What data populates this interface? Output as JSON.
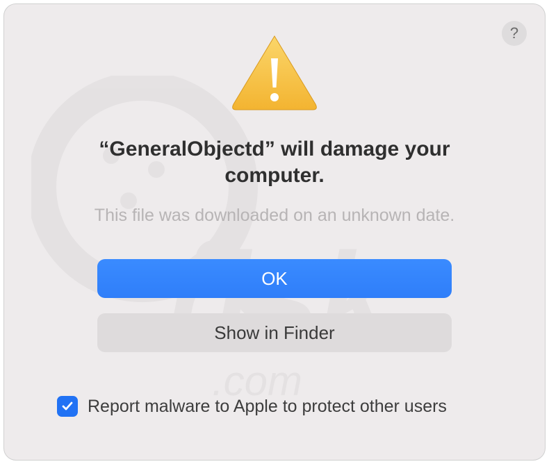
{
  "dialog": {
    "title": "“GeneralObjectd” will damage your computer.",
    "subtitle": "This file was downloaded on an unknown date.",
    "help_label": "?",
    "buttons": {
      "ok": "OK",
      "show_in_finder": "Show in Finder"
    },
    "checkbox": {
      "checked": true,
      "label": "Report malware to Apple to protect other users"
    }
  },
  "colors": {
    "primary": "#2f7ef9",
    "dialog_bg": "#eeebec",
    "secondary_btn": "#dedbdc",
    "subtitle_text": "#b7b4b5"
  }
}
